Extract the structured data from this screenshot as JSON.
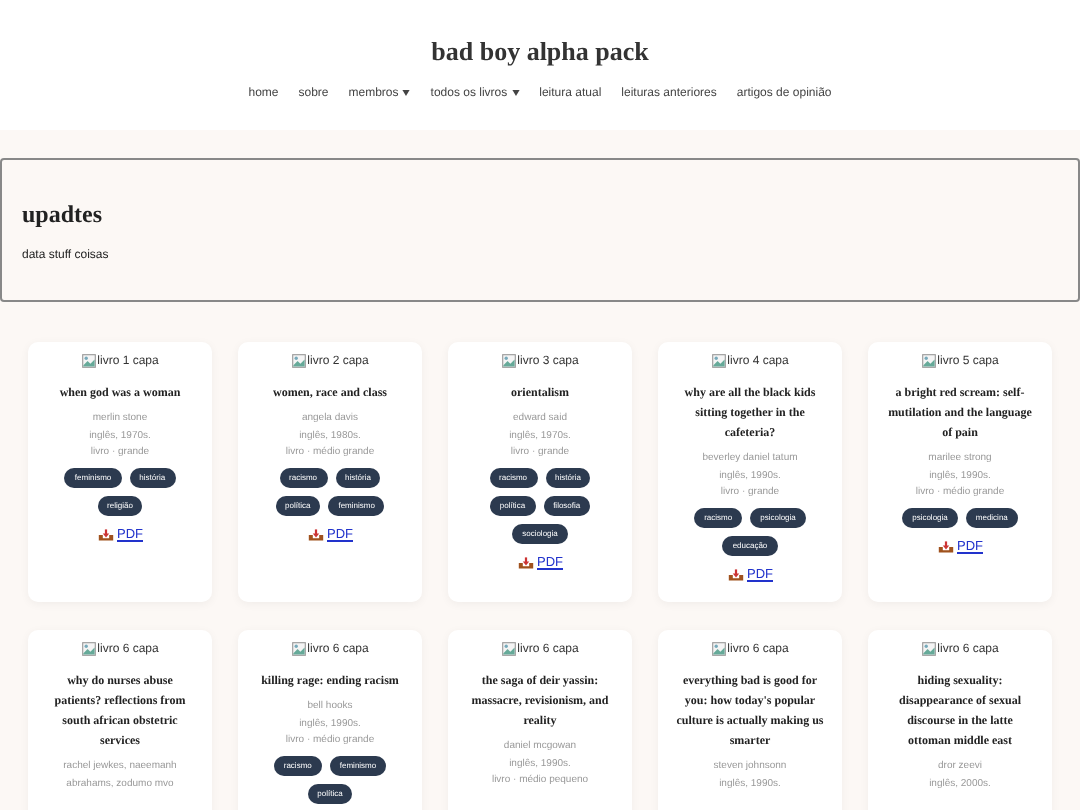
{
  "site_title": "bad boy alpha pack",
  "nav": [
    {
      "label": "home",
      "dropdown": false
    },
    {
      "label": "sobre",
      "dropdown": false
    },
    {
      "label": "membros",
      "dropdown": true
    },
    {
      "label": "todos os livros",
      "dropdown": true
    },
    {
      "label": "leitura atual",
      "dropdown": false
    },
    {
      "label": "leituras anteriores",
      "dropdown": false
    },
    {
      "label": "artigos de opinião",
      "dropdown": false
    }
  ],
  "updates": {
    "heading": "upadtes",
    "text": "data stuff coisas"
  },
  "books": [
    {
      "cover_alt": "livro 1 capa",
      "title": "when god was a woman",
      "meta": [
        "merlin stone",
        "inglês, 1970s.",
        "livro · grande"
      ],
      "tags": [
        "feminismo",
        "história",
        "religião"
      ],
      "pdf": "PDF"
    },
    {
      "cover_alt": "livro 2 capa",
      "title": "women, race and class",
      "meta": [
        "angela davis",
        "inglês, 1980s.",
        "livro · médio grande"
      ],
      "tags": [
        "racismo",
        "história",
        "política",
        "feminismo"
      ],
      "pdf": "PDF"
    },
    {
      "cover_alt": "livro 3 capa",
      "title": "orientalism",
      "meta": [
        "edward said",
        "inglês, 1970s.",
        "livro · grande"
      ],
      "tags": [
        "racismo",
        "história",
        "política",
        "filosofia",
        "sociologia"
      ],
      "pdf": "PDF"
    },
    {
      "cover_alt": "livro 4 capa",
      "title": "why are all the black kids sitting together in the cafeteria?",
      "meta": [
        "beverley daniel tatum",
        "inglês, 1990s.",
        "livro · grande"
      ],
      "tags": [
        "racismo",
        "psicologia",
        "educação"
      ],
      "pdf": "PDF"
    },
    {
      "cover_alt": "livro 5 capa",
      "title": "a bright red scream: self-mutilation and the language of pain",
      "meta": [
        "marilee strong",
        "inglês, 1990s.",
        "livro · médio grande"
      ],
      "tags": [
        "psicologia",
        "medicina"
      ],
      "pdf": "PDF"
    },
    {
      "cover_alt": "livro 6 capa",
      "title": "why do nurses abuse patients? reflections from south african obstetric services",
      "meta": [
        "rachel jewkes, naeemanh abrahams, zodumo mvo"
      ]
    },
    {
      "cover_alt": "livro 6 capa",
      "title": "killing rage: ending racism",
      "meta": [
        "bell hooks",
        "inglês, 1990s.",
        "livro · médio grande"
      ],
      "tags": [
        "racismo",
        "feminismo",
        "política"
      ]
    },
    {
      "cover_alt": "livro 6 capa",
      "title": "the saga of deir yassin: massacre, revisionism, and reality",
      "meta": [
        "daniel mcgowan",
        "inglês, 1990s.",
        "livro · médio pequeno"
      ]
    },
    {
      "cover_alt": "livro 6 capa",
      "title": "everything bad is good for you: how today's popular culture is actually making us smarter",
      "meta": [
        "steven johnsonn",
        "inglês, 1990s."
      ]
    },
    {
      "cover_alt": "livro 6 capa",
      "title": "hiding sexuality: disappearance of sexual discourse in the latte ottoman middle east",
      "meta": [
        "dror zeevi",
        "inglês, 2000s."
      ]
    }
  ]
}
